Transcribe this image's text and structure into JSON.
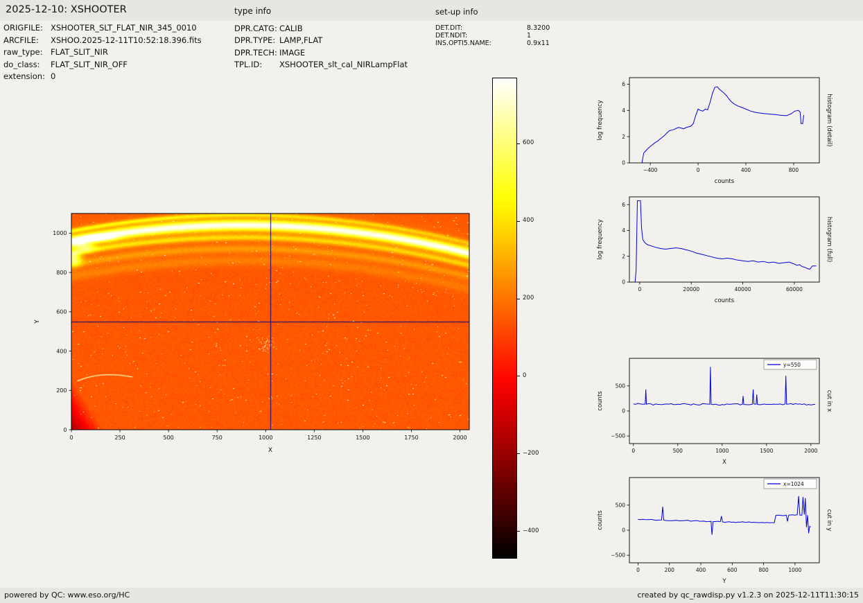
{
  "header": {
    "title": "2025-12-10: XSHOOTER",
    "type_info_label": "type info",
    "setup_info_label": "set-up info"
  },
  "file_info": {
    "rows": [
      {
        "label": "ORIGFILE:",
        "value": "XSHOOTER_SLT_FLAT_NIR_345_0010"
      },
      {
        "label": "ARCFILE:",
        "value": "XSHOO.2025-12-11T10:52:18.396.fits"
      },
      {
        "label": "raw_type:",
        "value": "FLAT_SLIT_NIR"
      },
      {
        "label": "do_class:",
        "value": "FLAT_SLIT_NIR_OFF"
      },
      {
        "label": "extension:",
        "value": "0"
      }
    ]
  },
  "type_info": {
    "rows": [
      {
        "label": "DPR.CATG:",
        "value": "CALIB"
      },
      {
        "label": "DPR.TYPE:",
        "value": "LAMP,FLAT"
      },
      {
        "label": "DPR.TECH:",
        "value": "IMAGE"
      },
      {
        "label": "TPL.ID:",
        "value": "XSHOOTER_slt_cal_NIRLampFlat"
      }
    ]
  },
  "setup_info": {
    "rows": [
      {
        "label": "DET.DIT:",
        "value": "8.3200"
      },
      {
        "label": "DET.NDIT:",
        "value": "1"
      },
      {
        "label": "INS.OPTI5.NAME:",
        "value": "0.9x11"
      }
    ]
  },
  "footer": {
    "left": "powered by QC: www.eso.org/HC",
    "right": "created by qc_rawdisp.py v1.2.3 on 2025-12-11T11:30:15"
  },
  "colors": {
    "page_bg": "#f2f1ed",
    "strip_bg": "#e8e6e1",
    "line_blue": "#0000dd",
    "crosshair_blue": "#00008b",
    "axis_black": "#000000"
  },
  "chart_data": [
    {
      "id": "detector-image",
      "type": "heatmap",
      "xlabel": "X",
      "ylabel": "Y",
      "xlim": [
        0,
        2048
      ],
      "ylim": [
        0,
        1100
      ],
      "xticks": [
        0,
        250,
        500,
        750,
        1000,
        1250,
        1500,
        1750,
        2000
      ],
      "yticks": [
        0,
        200,
        400,
        600,
        800,
        1000
      ],
      "value_range": [
        -470,
        770
      ],
      "colormap": "hot",
      "background_level": 145,
      "noise_amplitude": 26,
      "band_curve": {
        "vertex_x": 880,
        "vertex_y": 1040,
        "curvature": 0.000105
      },
      "bands": [
        {
          "offset": 0,
          "sigma": 26,
          "amplitude": 560,
          "fade_per_x": 0
        },
        {
          "offset": 52,
          "sigma": 12,
          "amplitude": 280,
          "fade_per_x": 0.0002
        },
        {
          "offset": -62,
          "sigma": 16,
          "amplitude": 235,
          "fade_per_x": 8e-05
        },
        {
          "offset": -120,
          "sigma": 20,
          "amplitude": 125,
          "fade_per_x": 8e-05
        },
        {
          "offset": -180,
          "sigma": 26,
          "amplitude": 80,
          "fade_per_x": 0.0001
        },
        {
          "offset": 0,
          "sigma": 85,
          "amplitude": 55,
          "fade_per_x": 0
        }
      ],
      "corner_shadow": {
        "x_extent": 170,
        "y_extent": 260,
        "depth": 320
      },
      "edge_blobs": [
        {
          "x": 12,
          "y": 868,
          "sx": 40,
          "sy": 34,
          "amplitude": 430
        },
        {
          "x": 60,
          "y": 932,
          "sx": 60,
          "sy": 26,
          "amplitude": 330
        },
        {
          "x": 150,
          "y": 974,
          "sx": 95,
          "sy": 20,
          "amplitude": 240
        }
      ],
      "scratch": {
        "from": [
          30,
          248
        ],
        "ctrl": [
          150,
          300
        ],
        "to": [
          315,
          268
        ],
        "value": 680
      },
      "speckles": {
        "count": 560,
        "seed": 11,
        "min_value": 430,
        "max_value": 900
      },
      "speckle_cluster": {
        "x": 1005,
        "y": 430,
        "sx": 60,
        "sy": 45,
        "count": 48
      },
      "crosshair": {
        "x": 1024,
        "y": 550
      }
    },
    {
      "id": "colorbar",
      "type": "colorbar",
      "colormap": "hot",
      "range": [
        -470,
        770
      ],
      "ticks": [
        600,
        400,
        200,
        0,
        -200,
        -400
      ]
    },
    {
      "id": "histogram-detail",
      "type": "line",
      "right_title": "histogram (detail)",
      "xlabel": "counts",
      "ylabel": "log frequency",
      "xlim": [
        -575,
        1015
      ],
      "ylim": [
        0,
        6.5
      ],
      "xticks": [
        -400,
        0,
        400,
        800
      ],
      "yticks": [
        0,
        2,
        4,
        6
      ],
      "noise": 0,
      "line_color": "#0000dd",
      "points": [
        [
          -470,
          0
        ],
        [
          -455,
          0.75
        ],
        [
          -440,
          0.9
        ],
        [
          -420,
          1.1
        ],
        [
          -400,
          1.25
        ],
        [
          -380,
          1.4
        ],
        [
          -360,
          1.55
        ],
        [
          -340,
          1.65
        ],
        [
          -320,
          1.8
        ],
        [
          -300,
          1.95
        ],
        [
          -280,
          2.1
        ],
        [
          -260,
          2.3
        ],
        [
          -240,
          2.45
        ],
        [
          -220,
          2.5
        ],
        [
          -200,
          2.55
        ],
        [
          -180,
          2.65
        ],
        [
          -160,
          2.7
        ],
        [
          -140,
          2.65
        ],
        [
          -120,
          2.6
        ],
        [
          -100,
          2.7
        ],
        [
          -80,
          2.75
        ],
        [
          -60,
          2.8
        ],
        [
          -40,
          3.0
        ],
        [
          -20,
          3.6
        ],
        [
          0,
          4.1
        ],
        [
          20,
          4.0
        ],
        [
          40,
          3.95
        ],
        [
          60,
          4.1
        ],
        [
          80,
          4.05
        ],
        [
          100,
          4.6
        ],
        [
          120,
          5.3
        ],
        [
          140,
          5.75
        ],
        [
          160,
          5.8
        ],
        [
          180,
          5.6
        ],
        [
          200,
          5.45
        ],
        [
          220,
          5.3
        ],
        [
          240,
          5.1
        ],
        [
          260,
          4.85
        ],
        [
          280,
          4.65
        ],
        [
          300,
          4.5
        ],
        [
          330,
          4.35
        ],
        [
          360,
          4.25
        ],
        [
          400,
          4.1
        ],
        [
          440,
          3.95
        ],
        [
          480,
          3.85
        ],
        [
          520,
          3.8
        ],
        [
          560,
          3.75
        ],
        [
          600,
          3.72
        ],
        [
          650,
          3.68
        ],
        [
          700,
          3.62
        ],
        [
          740,
          3.6
        ],
        [
          780,
          3.75
        ],
        [
          810,
          3.95
        ],
        [
          840,
          4.0
        ],
        [
          855,
          3.85
        ],
        [
          862,
          3.0
        ],
        [
          875,
          3.0
        ],
        [
          885,
          3.65
        ]
      ]
    },
    {
      "id": "histogram-full",
      "type": "line",
      "right_title": "histogram (full)",
      "xlabel": "counts",
      "ylabel": "log frequency",
      "xlim": [
        -4000,
        69700
      ],
      "ylim": [
        0,
        6.6
      ],
      "xticks": [
        0,
        20000,
        40000,
        60000
      ],
      "yticks": [
        0,
        2,
        4,
        6
      ],
      "noise": 0,
      "line_color": "#0000dd",
      "points": [
        [
          -1800,
          0
        ],
        [
          -1400,
          0.9
        ],
        [
          -900,
          6.3
        ],
        [
          300,
          6.3
        ],
        [
          700,
          4.2
        ],
        [
          1200,
          3.3
        ],
        [
          2000,
          3.05
        ],
        [
          3000,
          2.9
        ],
        [
          4500,
          2.8
        ],
        [
          6000,
          2.7
        ],
        [
          8000,
          2.6
        ],
        [
          10000,
          2.55
        ],
        [
          12000,
          2.6
        ],
        [
          14000,
          2.65
        ],
        [
          16000,
          2.6
        ],
        [
          18000,
          2.5
        ],
        [
          20000,
          2.4
        ],
        [
          22000,
          2.25
        ],
        [
          24000,
          2.15
        ],
        [
          26000,
          2.05
        ],
        [
          28000,
          1.95
        ],
        [
          30000,
          1.85
        ],
        [
          32000,
          1.8
        ],
        [
          34000,
          1.85
        ],
        [
          36000,
          1.8
        ],
        [
          38000,
          1.7
        ],
        [
          40000,
          1.65
        ],
        [
          42000,
          1.6
        ],
        [
          44000,
          1.65
        ],
        [
          46000,
          1.55
        ],
        [
          48000,
          1.6
        ],
        [
          50000,
          1.5
        ],
        [
          52000,
          1.55
        ],
        [
          54000,
          1.45
        ],
        [
          56000,
          1.5
        ],
        [
          58000,
          1.55
        ],
        [
          60000,
          1.4
        ],
        [
          61000,
          1.3
        ],
        [
          62000,
          1.35
        ],
        [
          63000,
          1.2
        ],
        [
          64000,
          1.15
        ],
        [
          65000,
          1.05
        ],
        [
          66000,
          1.0
        ],
        [
          67000,
          1.25
        ],
        [
          68500,
          1.25
        ]
      ]
    },
    {
      "id": "cut-in-x",
      "type": "line",
      "right_title": "cut in x",
      "xlabel": "X",
      "ylabel": "counts",
      "legend": "y=550",
      "xlim": [
        -45,
        2095
      ],
      "ylim": [
        -650,
        1050
      ],
      "xticks": [
        0,
        500,
        1000,
        1500,
        2000
      ],
      "yticks": [
        -500,
        0,
        500
      ],
      "noise": 16,
      "seed": 3,
      "line_color": "#0000dd",
      "points": [
        [
          0,
          140
        ],
        [
          100,
          135
        ],
        [
          133,
          138
        ],
        [
          140,
          430
        ],
        [
          147,
          135
        ],
        [
          300,
          130
        ],
        [
          500,
          135
        ],
        [
          700,
          130
        ],
        [
          860,
          135
        ],
        [
          868,
          880
        ],
        [
          876,
          135
        ],
        [
          1000,
          130
        ],
        [
          1100,
          135
        ],
        [
          1228,
          135
        ],
        [
          1236,
          300
        ],
        [
          1244,
          130
        ],
        [
          1340,
          135
        ],
        [
          1350,
          430
        ],
        [
          1358,
          140
        ],
        [
          1383,
          135
        ],
        [
          1390,
          330
        ],
        [
          1398,
          130
        ],
        [
          1600,
          135
        ],
        [
          1710,
          140
        ],
        [
          1718,
          700
        ],
        [
          1726,
          135
        ],
        [
          1900,
          130
        ],
        [
          2048,
          135
        ]
      ]
    },
    {
      "id": "cut-in-y",
      "type": "line",
      "right_title": "cut in y",
      "xlabel": "Y",
      "ylabel": "counts",
      "legend": "x=1024",
      "xlim": [
        -55,
        1155
      ],
      "ylim": [
        -650,
        1050
      ],
      "xticks": [
        0,
        200,
        400,
        600,
        800,
        1000
      ],
      "yticks": [
        -500,
        0,
        500
      ],
      "noise": 9,
      "seed": 5,
      "line_color": "#0000dd",
      "points": [
        [
          0,
          215
        ],
        [
          60,
          210
        ],
        [
          100,
          205
        ],
        [
          150,
          206
        ],
        [
          157,
          470
        ],
        [
          164,
          200
        ],
        [
          250,
          195
        ],
        [
          350,
          185
        ],
        [
          420,
          180
        ],
        [
          465,
          176
        ],
        [
          471,
          -90
        ],
        [
          478,
          172
        ],
        [
          524,
          170
        ],
        [
          531,
          280
        ],
        [
          538,
          166
        ],
        [
          650,
          160
        ],
        [
          750,
          155
        ],
        [
          850,
          150
        ],
        [
          868,
          150
        ],
        [
          878,
          295
        ],
        [
          900,
          300
        ],
        [
          925,
          290
        ],
        [
          945,
          300
        ],
        [
          952,
          175
        ],
        [
          960,
          300
        ],
        [
          980,
          308
        ],
        [
          1000,
          300
        ],
        [
          1014,
          308
        ],
        [
          1023,
          680
        ],
        [
          1031,
          300
        ],
        [
          1044,
          300
        ],
        [
          1051,
          660
        ],
        [
          1059,
          310
        ],
        [
          1066,
          640
        ],
        [
          1073,
          60
        ],
        [
          1080,
          300
        ],
        [
          1087,
          -60
        ],
        [
          1093,
          75
        ],
        [
          1100,
          65
        ]
      ]
    }
  ]
}
